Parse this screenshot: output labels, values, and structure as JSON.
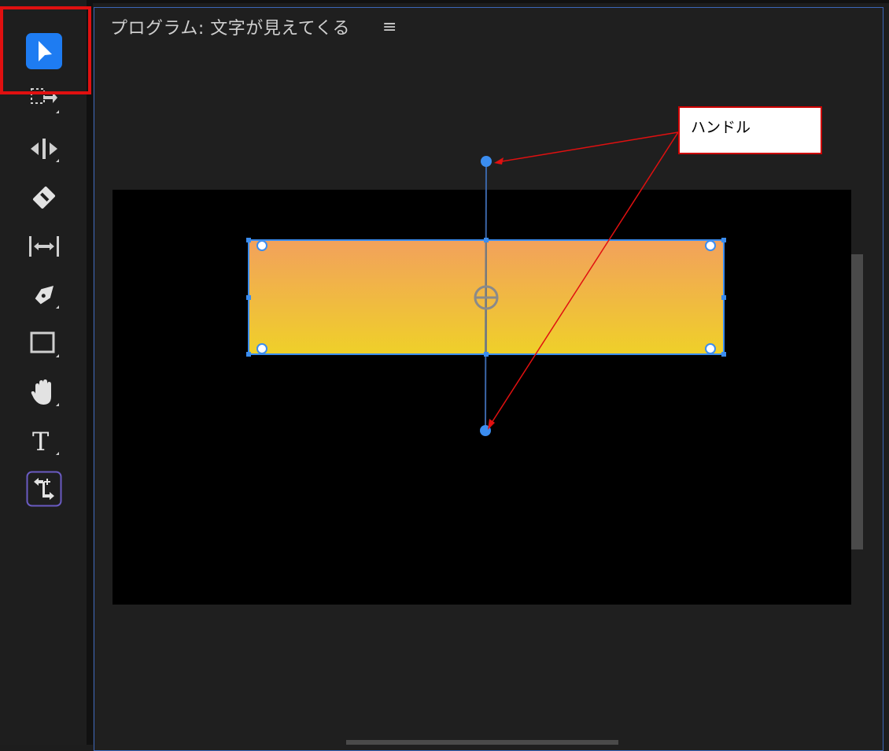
{
  "panel": {
    "title": "プログラム: 文字が見えてくる",
    "menu_glyph": "≡"
  },
  "callout": {
    "label": "ハンドル"
  },
  "tools": [
    {
      "name": "selection-tool",
      "selected": true
    },
    {
      "name": "track-select-tool"
    },
    {
      "name": "ripple-edit-tool"
    },
    {
      "name": "razor-tool"
    },
    {
      "name": "slip-tool"
    },
    {
      "name": "pen-tool"
    },
    {
      "name": "rectangle-tool"
    },
    {
      "name": "hand-tool"
    },
    {
      "name": "type-tool"
    },
    {
      "name": "remix-tool"
    }
  ],
  "colors": {
    "accent": "#1e7cf2",
    "highlight": "#e01010",
    "gradient_top": "#f2a15c",
    "gradient_bottom": "#efd029",
    "handle": "#3b8df0"
  },
  "icons": {
    "type_glyph": "T"
  }
}
